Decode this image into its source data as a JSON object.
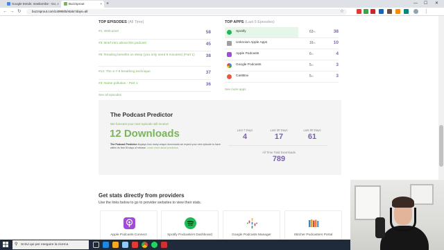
{
  "browser": {
    "tabs": [
      {
        "title": "Google trends: newbornbe - Go...",
        "active": false
      },
      {
        "title": "Buzzsprout",
        "active": true
      }
    ],
    "url": "buzzsprout.com/1499505/stats?days=all"
  },
  "top_episodes": {
    "title": "TOP EPISODES",
    "subtitle": "(All Time)",
    "items": [
      {
        "title": "#1: Welcome!",
        "count": "58"
      },
      {
        "title": "#3: Brief intro about this podcast",
        "count": "45"
      },
      {
        "title": "#8: Reading benefits on sleep (you only need 8 minutes!) (Part 1)",
        "count": "38"
      },
      {
        "title": "#12: The 4-7-8 breathing technique",
        "count": "37"
      },
      {
        "title": "#3: Noise pollution - Part 1",
        "count": "36"
      }
    ],
    "see_all": "See all episodes"
  },
  "top_apps": {
    "title": "TOP APPS",
    "subtitle": "(Last 5 Episodes)",
    "items": [
      {
        "name": "Spotify",
        "percent": "63",
        "count": "38",
        "color": "#1db954"
      },
      {
        "name": "Unknown Apple Apps",
        "percent": "16",
        "count": "10",
        "color": "#9e9e9e"
      },
      {
        "name": "Apple Podcasts",
        "percent": "6",
        "count": "4",
        "color": "#a24ad9"
      },
      {
        "name": "Google Podcasts",
        "percent": "5",
        "count": "3",
        "color": "#f2a93b"
      },
      {
        "name": "CastBox",
        "percent": "5",
        "count": "3",
        "color": "#e8573f"
      }
    ],
    "percent_suffix": "%",
    "see_more": "See more apps"
  },
  "predictor": {
    "title": "The Podcast Predictor",
    "forecast_line": "We forecast your next episode will receive",
    "forecast_value": "12 Downloads",
    "description_bold": "The Podcast Predictor",
    "description": "displays how many unique downloads we expect your next episode to have within its first 90 days of release.",
    "description_link": "Learn more about prediction",
    "stats": [
      {
        "label": "Last 7 Days",
        "value": "4"
      },
      {
        "label": "Last 30 Days",
        "value": "17"
      },
      {
        "label": "Last 90 Days",
        "value": "61"
      }
    ],
    "total_label": "All Time Total Downloads",
    "total_value": "789"
  },
  "providers": {
    "title": "Get stats directly from providers",
    "subtitle": "Use the links below to go to provider websites to view their stats.",
    "cards": [
      {
        "label": "Apple Podcasts Connect",
        "icon": "apple-podcasts-icon"
      },
      {
        "label": "Spotify Podcasters Dashboard",
        "icon": "spotify-icon"
      },
      {
        "label": "Google Podcasts Manager",
        "icon": "google-podcasts-icon"
      },
      {
        "label": "Stitcher Podcasters Portal",
        "icon": "stitcher-icon"
      }
    ]
  },
  "taskbar": {
    "search_placeholder": "Scrivi qui per eseguire la ricerca"
  }
}
